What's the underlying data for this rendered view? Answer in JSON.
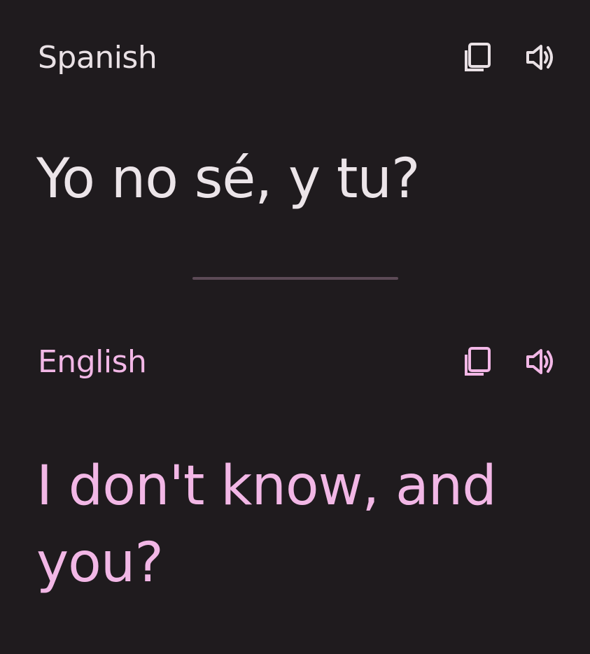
{
  "source": {
    "language": "Spanish",
    "text": "Yo no sé, y tu?",
    "copy_icon": "copy-icon",
    "speaker_icon": "speaker-icon"
  },
  "target": {
    "language": "English",
    "text": "I don't know, and you?",
    "copy_icon": "copy-icon",
    "speaker_icon": "speaker-icon"
  },
  "colors": {
    "background": "#1f1b1e",
    "source_text": "#ece5e9",
    "target_text": "#f2b7e6",
    "divider": "#5c4a56"
  }
}
